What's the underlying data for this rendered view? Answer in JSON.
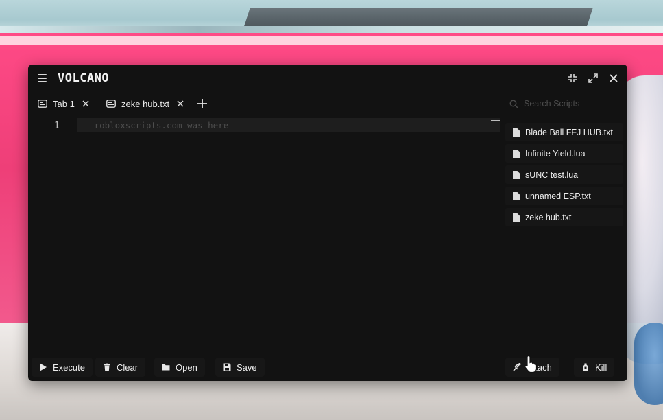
{
  "app": {
    "title": "VOLCANO"
  },
  "tabs": [
    {
      "label": "Tab 1"
    },
    {
      "label": "zeke hub.txt"
    }
  ],
  "editor": {
    "line_numbers": [
      "1"
    ],
    "lines": [
      "-- robloxscripts.com was here"
    ]
  },
  "search": {
    "placeholder": "Search Scripts"
  },
  "scripts": [
    {
      "label": "Blade Ball FFJ HUB.txt"
    },
    {
      "label": "Infinite Yield.lua"
    },
    {
      "label": "sUNC test.lua"
    },
    {
      "label": "unnamed ESP.txt"
    },
    {
      "label": "zeke hub.txt"
    }
  ],
  "toolbar": {
    "execute": "Execute",
    "clear": "Clear",
    "open": "Open",
    "save": "Save",
    "attach": "Attach",
    "kill": "Kill"
  },
  "icons": {
    "menu": "hamburger-icon",
    "minimize": "shrink-icon",
    "maximize": "expand-icon",
    "close": "close-icon",
    "tab": "code-tab-icon",
    "add_tab": "plus-icon",
    "search": "search-icon",
    "script": "file-icon",
    "execute": "play-icon",
    "clear": "trash-icon",
    "open": "folder-icon",
    "save": "floppy-icon",
    "attach": "syringe-icon",
    "kill": "bottle-icon"
  },
  "colors": {
    "window_bg": "#121212",
    "panel_item_bg": "#161616",
    "text": "#ececec",
    "muted": "#4d4d4d",
    "background_pink": "#ee3f78"
  }
}
